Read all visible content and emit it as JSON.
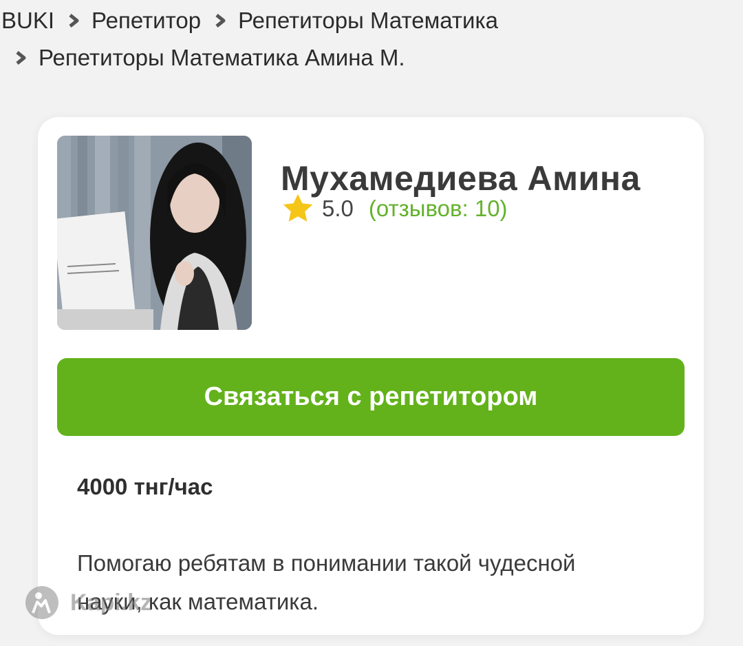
{
  "breadcrumb": {
    "items": [
      "BUKI",
      "Репетитор",
      "Репетиторы Математика",
      "Репетиторы Математика Амина М."
    ]
  },
  "profile": {
    "name": "Мухамедиева Амина",
    "rating": "5.0",
    "reviews": "(отзывов: 10)",
    "contact_button": "Связаться с репетитором",
    "price": "4000 тнг/час",
    "description": "Помогаю ребятам в понимании такой чудесной науки, как математика."
  },
  "watermark": {
    "text": "Kapi.kz"
  },
  "colors": {
    "accent": "#63b21b",
    "review_text": "#63b22b",
    "star": "#f5c518",
    "background": "#f2f2f2"
  },
  "icons": [
    "chevron-right-icon",
    "star-icon",
    "watermark-logo-icon"
  ]
}
